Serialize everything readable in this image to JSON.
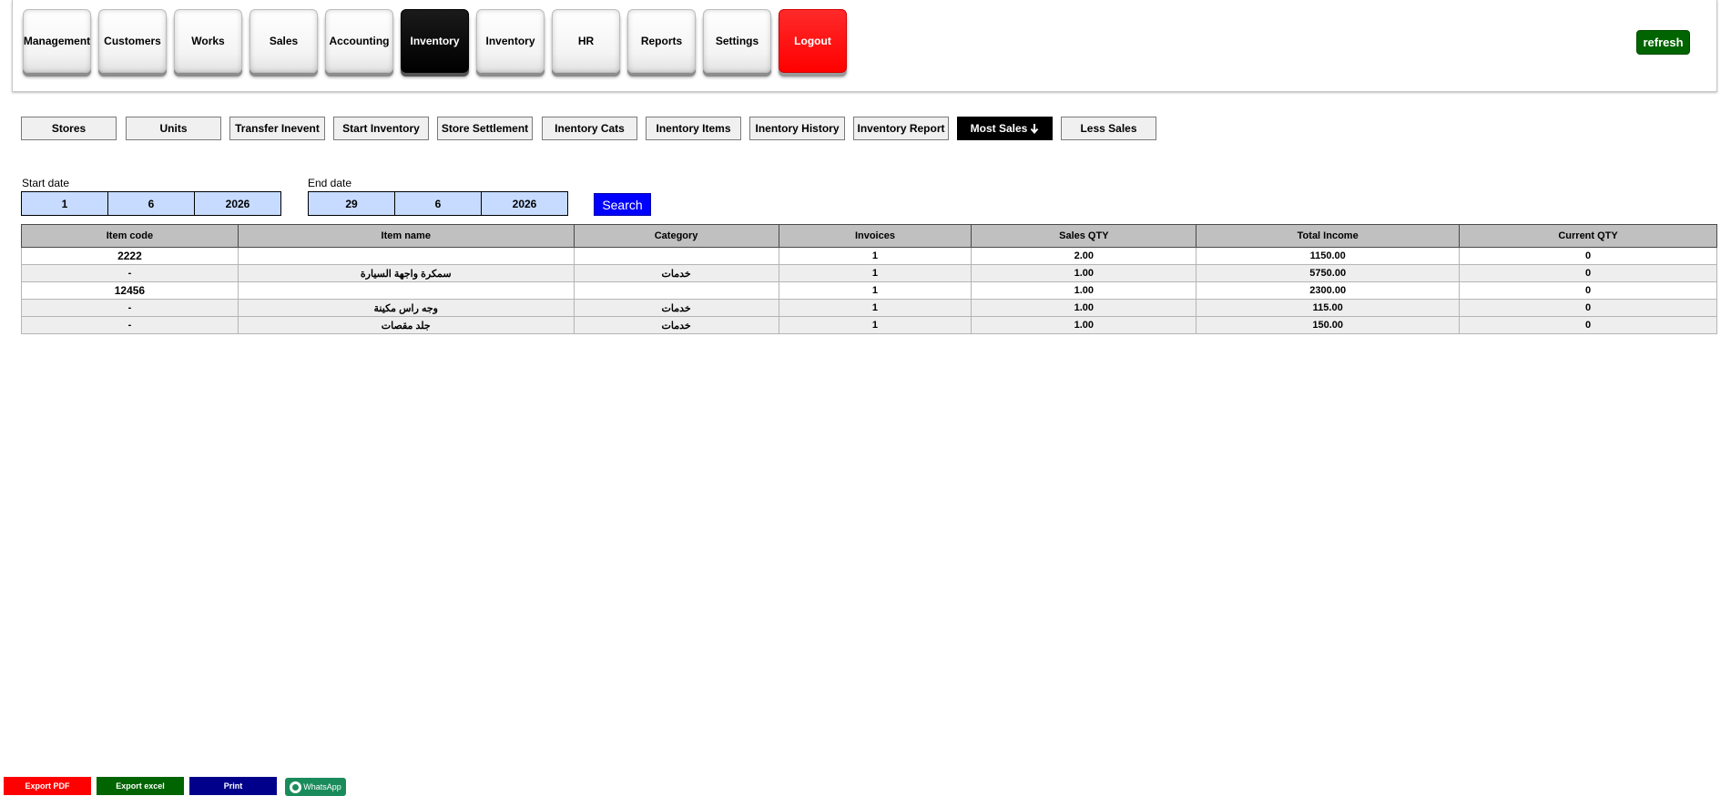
{
  "nav": {
    "items": [
      "Management",
      "Customers",
      "Works",
      "Sales",
      "Accounting",
      "Inventory",
      "Inventory",
      "HR",
      "Reports",
      "Settings"
    ],
    "logout": "Logout",
    "refresh": "refresh"
  },
  "subnav": {
    "items": [
      "Stores",
      "Units",
      "Transfer Inevent",
      "Start Inventory",
      "Store Settlement",
      "Inentory Cats",
      "Inentory Items",
      "Inentory History",
      "Inventory Report",
      "Most Sales",
      "Less Sales"
    ]
  },
  "filters": {
    "start_label": "Start date",
    "start": {
      "day": "1",
      "month": "6",
      "year": "2026"
    },
    "end_label": "End date",
    "end": {
      "day": "29",
      "month": "6",
      "year": "2026"
    },
    "search": "Search"
  },
  "table": {
    "headers": [
      "Item code",
      "Item name",
      "Category",
      "Invoices",
      "Sales QTY",
      "Total Income",
      "Current QTY"
    ],
    "rows": [
      [
        "2222",
        "",
        "",
        "1",
        "2.00",
        "1150.00",
        "0"
      ],
      [
        "-",
        "سمكرة واجهة السيارة",
        "خدمات",
        "1",
        "1.00",
        "5750.00",
        "0"
      ],
      [
        "12456",
        "",
        "",
        "1",
        "1.00",
        "2300.00",
        "0"
      ],
      [
        "-",
        "وجه راس مكينة",
        "خدمات",
        "1",
        "1.00",
        "115.00",
        "0"
      ],
      [
        "-",
        "جلد مقصات",
        "خدمات",
        "1",
        "1.00",
        "150.00",
        "0"
      ]
    ]
  },
  "footer": {
    "export_pdf": "Export PDF",
    "export_excel": "Export excel",
    "print": "Print",
    "whatsapp": "WhatsApp"
  },
  "colors": {
    "logout": "#ff0000",
    "refresh": "#006400",
    "search": "#0000ff",
    "date_field": "#c6dbff",
    "export_pdf": "#ff0000",
    "export_excel": "#006400",
    "print": "#00008b",
    "whatsapp": "#1a8c5c"
  }
}
